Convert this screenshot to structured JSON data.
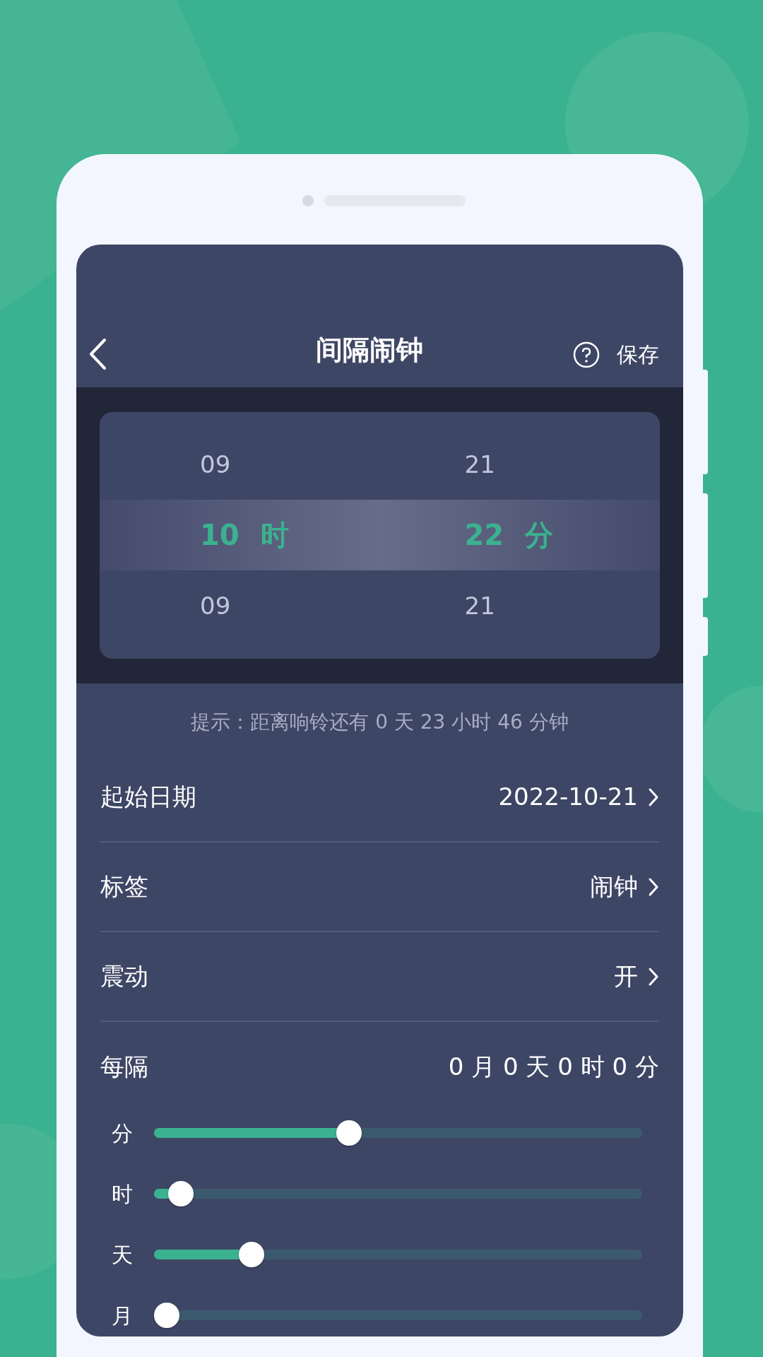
{
  "header": {
    "title": "间隔闹钟",
    "save": "保存"
  },
  "picker": {
    "columns": [
      {
        "items": [
          {
            "text": "09",
            "selected": false
          },
          {
            "text": "10",
            "unit": "时",
            "selected": true
          },
          {
            "text": "09",
            "selected": false
          }
        ]
      },
      {
        "items": [
          {
            "text": "21",
            "selected": false
          },
          {
            "text": "22",
            "unit": "分",
            "selected": true
          },
          {
            "text": "21",
            "selected": false
          }
        ]
      }
    ]
  },
  "hint": "提示：距离响铃还有 0 天 23 小时 46 分钟",
  "settings": [
    {
      "kind": "link",
      "label": "起始日期",
      "value": "2022-10-21"
    },
    {
      "kind": "link",
      "label": "标签",
      "value": "闹钟"
    },
    {
      "kind": "link",
      "label": "震动",
      "value": "开"
    },
    {
      "kind": "text",
      "label": "每隔",
      "value": "0 月 0 天 0 时 0 分"
    }
  ],
  "sliders": [
    {
      "label": "分",
      "level": 0.4
    },
    {
      "label": "时",
      "level": 0.055
    },
    {
      "label": "天",
      "level": 0.2
    },
    {
      "label": "月",
      "level": 0
    }
  ]
}
